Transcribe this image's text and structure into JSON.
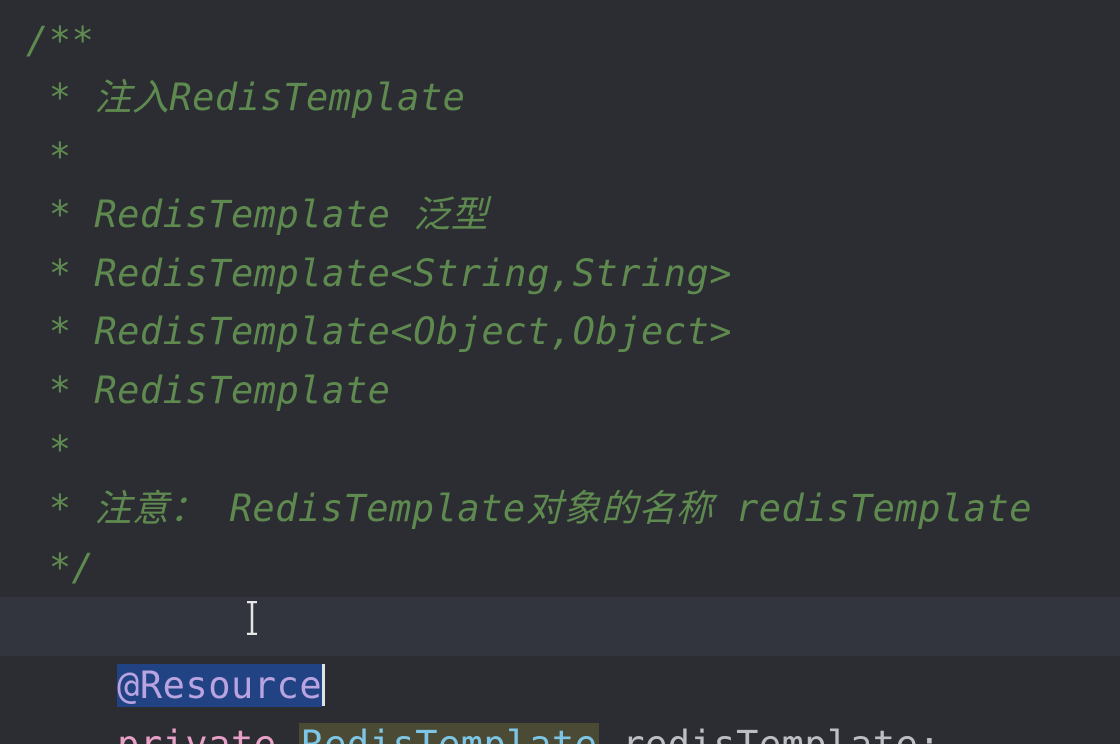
{
  "editor": {
    "comment_lines": [
      "/**",
      " * 注入RedisTemplate",
      " *",
      " * RedisTemplate 泛型",
      " * RedisTemplate<String,String>",
      " * RedisTemplate<Object,Object>",
      " * RedisTemplate",
      " *",
      " * 注意： RedisTemplate对象的名称 redisTemplate",
      " */"
    ],
    "annotation": "@Resource",
    "field": {
      "modifier": "private",
      "type": "RedisTemplate",
      "name": "redisTemplate",
      "terminator": ";"
    }
  },
  "colors": {
    "background": "#2b2d33",
    "comment": "#5f8a4f",
    "annotation": "#b9a3e0",
    "keyword": "#e9a0c8",
    "type": "#7ec6e6",
    "selection": "#214283"
  }
}
